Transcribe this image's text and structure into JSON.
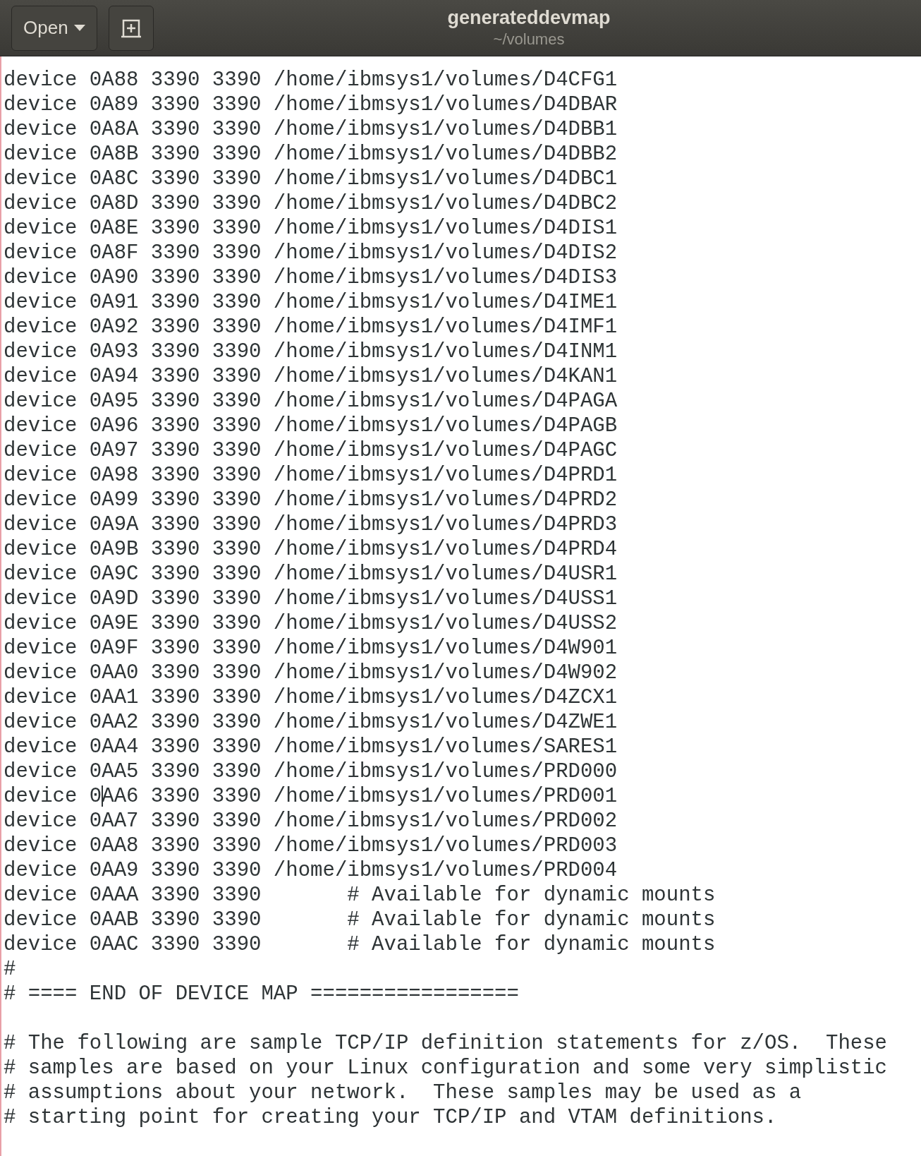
{
  "header": {
    "open_button": "Open",
    "title": "generateddevmap",
    "subtitle": "~/volumes"
  },
  "lines": [
    {
      "text": "device 0A88 3390 3390 /home/ibmsys1/volumes/D4CFG1"
    },
    {
      "text": "device 0A89 3390 3390 /home/ibmsys1/volumes/D4DBAR"
    },
    {
      "text": "device 0A8A 3390 3390 /home/ibmsys1/volumes/D4DBB1"
    },
    {
      "text": "device 0A8B 3390 3390 /home/ibmsys1/volumes/D4DBB2"
    },
    {
      "text": "device 0A8C 3390 3390 /home/ibmsys1/volumes/D4DBC1"
    },
    {
      "text": "device 0A8D 3390 3390 /home/ibmsys1/volumes/D4DBC2"
    },
    {
      "text": "device 0A8E 3390 3390 /home/ibmsys1/volumes/D4DIS1"
    },
    {
      "text": "device 0A8F 3390 3390 /home/ibmsys1/volumes/D4DIS2"
    },
    {
      "text": "device 0A90 3390 3390 /home/ibmsys1/volumes/D4DIS3"
    },
    {
      "text": "device 0A91 3390 3390 /home/ibmsys1/volumes/D4IME1"
    },
    {
      "text": "device 0A92 3390 3390 /home/ibmsys1/volumes/D4IMF1"
    },
    {
      "text": "device 0A93 3390 3390 /home/ibmsys1/volumes/D4INM1"
    },
    {
      "text": "device 0A94 3390 3390 /home/ibmsys1/volumes/D4KAN1"
    },
    {
      "text": "device 0A95 3390 3390 /home/ibmsys1/volumes/D4PAGA"
    },
    {
      "text": "device 0A96 3390 3390 /home/ibmsys1/volumes/D4PAGB"
    },
    {
      "text": "device 0A97 3390 3390 /home/ibmsys1/volumes/D4PAGC"
    },
    {
      "text": "device 0A98 3390 3390 /home/ibmsys1/volumes/D4PRD1"
    },
    {
      "text": "device 0A99 3390 3390 /home/ibmsys1/volumes/D4PRD2"
    },
    {
      "text": "device 0A9A 3390 3390 /home/ibmsys1/volumes/D4PRD3"
    },
    {
      "text": "device 0A9B 3390 3390 /home/ibmsys1/volumes/D4PRD4"
    },
    {
      "text": "device 0A9C 3390 3390 /home/ibmsys1/volumes/D4USR1"
    },
    {
      "text": "device 0A9D 3390 3390 /home/ibmsys1/volumes/D4USS1"
    },
    {
      "text": "device 0A9E 3390 3390 /home/ibmsys1/volumes/D4USS2"
    },
    {
      "text": "device 0A9F 3390 3390 /home/ibmsys1/volumes/D4W901"
    },
    {
      "text": "device 0AA0 3390 3390 /home/ibmsys1/volumes/D4W902"
    },
    {
      "text": "device 0AA1 3390 3390 /home/ibmsys1/volumes/D4ZCX1"
    },
    {
      "text": "device 0AA2 3390 3390 /home/ibmsys1/volumes/D4ZWE1"
    },
    {
      "text": "device 0AA4 3390 3390 /home/ibmsys1/volumes/SARES1"
    },
    {
      "text": "device 0AA5 3390 3390 /home/ibmsys1/volumes/PRD000"
    },
    {
      "kind": "cursor",
      "text_before": "device 0",
      "text_after": "AA6 3390 3390 /home/ibmsys1/volumes/PRD001"
    },
    {
      "text": "device 0AA7 3390 3390 /home/ibmsys1/volumes/PRD002"
    },
    {
      "text": "device 0AA8 3390 3390 /home/ibmsys1/volumes/PRD003"
    },
    {
      "text": "device 0AA9 3390 3390 /home/ibmsys1/volumes/PRD004"
    },
    {
      "text": "device 0AAA 3390 3390       # Available for dynamic mounts"
    },
    {
      "text": "device 0AAB 3390 3390       # Available for dynamic mounts"
    },
    {
      "text": "device 0AAC 3390 3390       # Available for dynamic mounts"
    },
    {
      "text": "#"
    },
    {
      "text": "# ==== END OF DEVICE MAP ================="
    },
    {
      "kind": "blank"
    },
    {
      "text": "# The following are sample TCP/IP definition statements for z/OS.  These"
    },
    {
      "text": "# samples are based on your Linux configuration and some very simplistic"
    },
    {
      "text": "# assumptions about your network.  These samples may be used as a"
    },
    {
      "text": "# starting point for creating your TCP/IP and VTAM definitions."
    }
  ]
}
